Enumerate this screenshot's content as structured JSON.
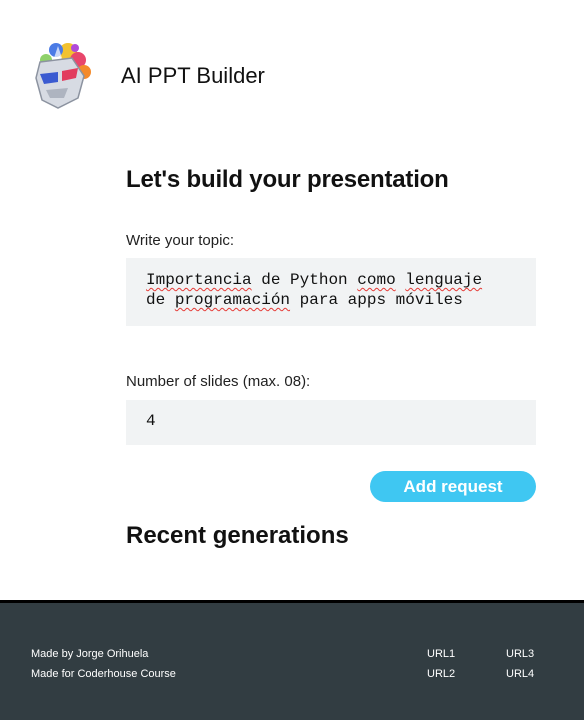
{
  "header": {
    "app_title": "AI PPT Builder",
    "logo_icon": "colorful-mask-logo-icon"
  },
  "main": {
    "page_title": "Let's build your presentation",
    "topic_label": "Write your topic:",
    "topic_line1_words": [
      "Importancia",
      "de",
      "Python",
      "como",
      "lenguaje"
    ],
    "topic_line2_words": [
      "de",
      "programación",
      "para",
      "apps",
      "móviles"
    ],
    "slides_label": "Number of slides (max. 08):",
    "slides_value": "4",
    "add_button": "Add request",
    "recent_title": "Recent generations"
  },
  "footer": {
    "made_by": "Made by Jorge Orihuela",
    "made_for": "Made for Coderhouse Course",
    "links": [
      "URL1",
      "URL2",
      "URL3",
      "URL4"
    ]
  },
  "colors": {
    "accent": "#3fc7f2",
    "footer_bg": "#323d42",
    "input_bg": "#f1f3f4",
    "spellcheck": "#e53935"
  }
}
